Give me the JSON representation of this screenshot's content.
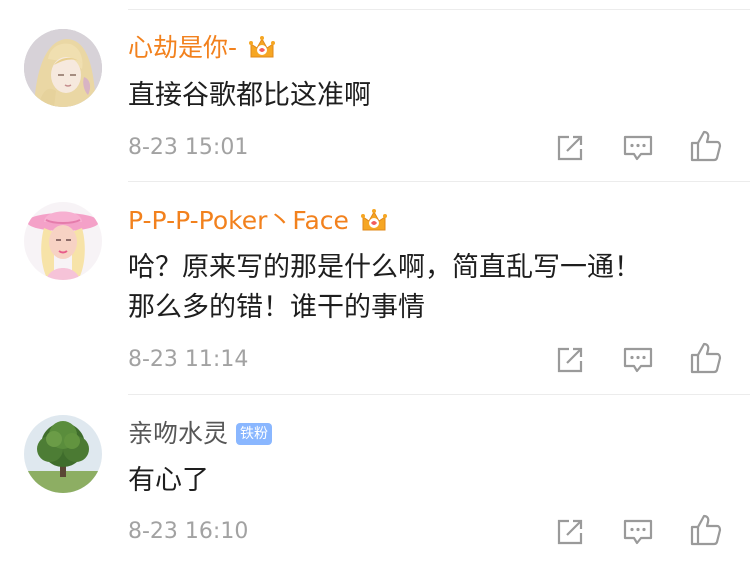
{
  "comments": [
    {
      "username": "心劫是你-",
      "badge": "crown-vip-icon",
      "text_lines": [
        "直接谷歌都比这准啊"
      ],
      "timestamp": "8-23 15:01",
      "avatar": "anime-girl-avatar"
    },
    {
      "username": "P-P-P-Poker丶Face",
      "badge": "crown-vip-icon",
      "text_lines": [
        "哈？原来写的那是什么啊，简直乱写一通！",
        "那么多的错！谁干的事情"
      ],
      "timestamp": "8-23 11:14",
      "avatar": "pink-cowboy-hat-avatar"
    },
    {
      "username": "亲吻水灵",
      "badge_label": "铁粉",
      "text_lines": [
        "有心了"
      ],
      "timestamp": "8-23 16:10",
      "avatar": "tree-avatar"
    }
  ],
  "actions": [
    "share-icon",
    "comment-icon",
    "like-icon"
  ],
  "colors": {
    "vip_name": "#f2811d",
    "normal_name": "#575757",
    "body_text": "#1e1e1e",
    "meta_text": "#a2a2a2",
    "icon": "#9a9a9a",
    "fan_badge": "#8ab7ff"
  }
}
